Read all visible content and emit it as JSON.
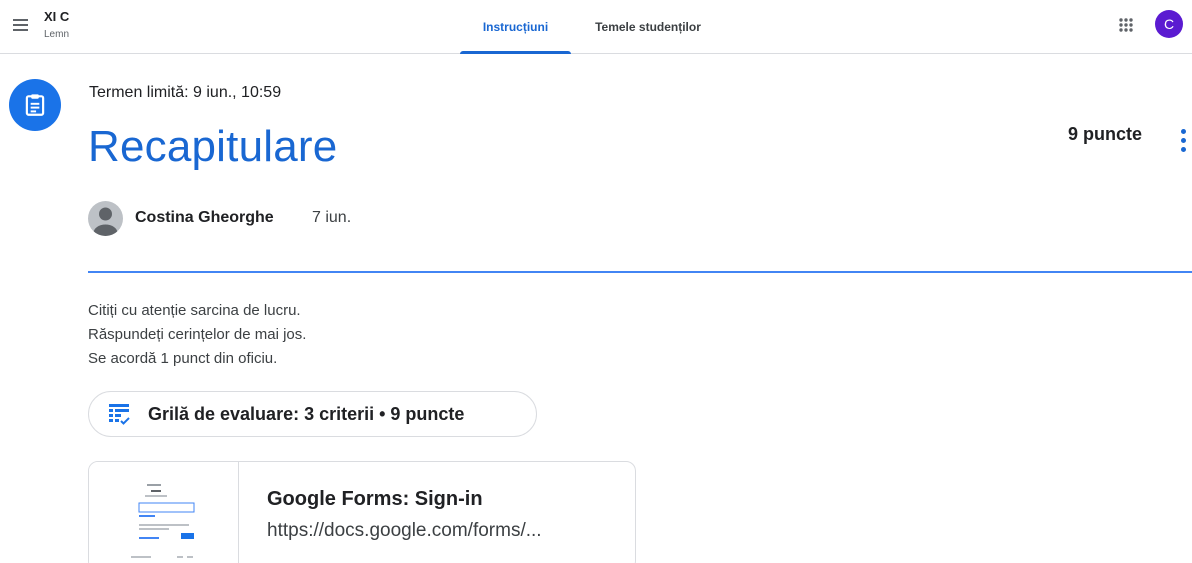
{
  "header": {
    "class_name": "XI C",
    "class_section": "Lemn",
    "tabs": [
      {
        "label": "Instrucțiuni",
        "active": true
      },
      {
        "label": "Temele studenților",
        "active": false
      }
    ],
    "user_initial": "C",
    "user_avatar_color": "#5b1bd1",
    "icons": [
      "menu-icon",
      "apps-grid-icon"
    ]
  },
  "assignment": {
    "icon": "assignment-icon",
    "due": "Termen limită: 9 iun., 10:59",
    "title": "Recapitulare",
    "points": "9 puncte",
    "author": "Costina Gheorghe",
    "posted_date": "7 iun.",
    "description": [
      "Citiți cu atenție sarcina de lucru.",
      "Răspundeți cerințelor de mai jos.",
      "Se acordă 1 punct din oficiu."
    ],
    "rubric": "Grilă de evaluare: 3 criterii • 9 puncte",
    "attachment": {
      "title": "Google Forms: Sign-in",
      "url": "https://docs.google.com/forms/..."
    }
  },
  "colors": {
    "accent": "#1967d2",
    "divider": "#4285f4",
    "assignment_icon_bg": "#1a73e8"
  }
}
